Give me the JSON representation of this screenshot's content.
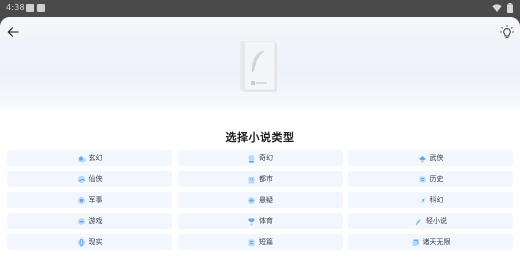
{
  "status_bar": {
    "time": "4:38",
    "icons": [
      "notification-icon",
      "notification-icon",
      "wifi-icon",
      "battery-icon"
    ]
  },
  "header": {
    "back_icon": "arrow-left-icon",
    "theme_icon": "lightbulb-icon"
  },
  "hero": {
    "book_icon": "book-feather-icon"
  },
  "title": "选择小说类型",
  "genres": [
    {
      "label": "玄幻",
      "icon": "cloud-icon"
    },
    {
      "label": "奇幻",
      "icon": "crystal-ball-icon"
    },
    {
      "label": "武侠",
      "icon": "sword-icon"
    },
    {
      "label": "仙侠",
      "icon": "moon-icon"
    },
    {
      "label": "都市",
      "icon": "building-icon"
    },
    {
      "label": "历史",
      "icon": "scroll-icon"
    },
    {
      "label": "军事",
      "icon": "military-icon"
    },
    {
      "label": "悬疑",
      "icon": "eye-icon"
    },
    {
      "label": "科幻",
      "icon": "rocket-icon"
    },
    {
      "label": "游戏",
      "icon": "gamepad-icon"
    },
    {
      "label": "体育",
      "icon": "trophy-icon"
    },
    {
      "label": "轻小说",
      "icon": "feather-icon"
    },
    {
      "label": "现实",
      "icon": "globe-icon"
    },
    {
      "label": "短篇",
      "icon": "document-icon"
    },
    {
      "label": "诸天无限",
      "icon": "stack-icon"
    }
  ],
  "colors": {
    "accent": "#6aa6ec",
    "accent_light": "#bcd8f8",
    "button_bg": "#f2f6fd",
    "status_bar_bg": "#4a4a4a"
  }
}
